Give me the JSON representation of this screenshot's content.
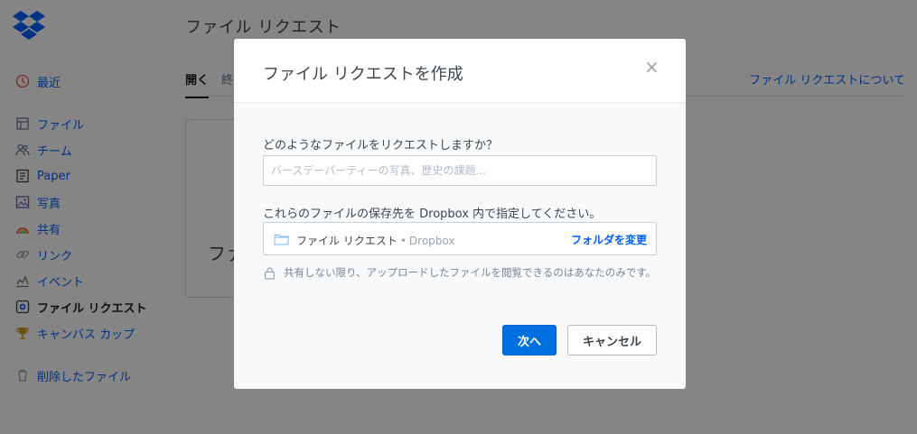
{
  "app": {
    "page_title": "ファイル リクエスト",
    "about_link": "ファイル リクエストについて",
    "card_text": "ファ"
  },
  "sidebar": {
    "items": [
      {
        "label": "最近",
        "icon": "clock-icon"
      },
      {
        "label": "ファイル",
        "icon": "files-icon"
      },
      {
        "label": "チーム",
        "icon": "team-icon"
      },
      {
        "label": "Paper",
        "icon": "paper-icon"
      },
      {
        "label": "写真",
        "icon": "photos-icon"
      },
      {
        "label": "共有",
        "icon": "sharing-icon"
      },
      {
        "label": "リンク",
        "icon": "link-icon"
      },
      {
        "label": "イベント",
        "icon": "events-icon"
      },
      {
        "label": "ファイル リクエスト",
        "icon": "file-request-icon",
        "active": true
      },
      {
        "label": "キャンバス カップ",
        "icon": "trophy-icon"
      },
      {
        "label": "削除したファイル",
        "icon": "trash-icon"
      }
    ]
  },
  "tabs": [
    {
      "label": "開く",
      "active": true
    },
    {
      "label": "終"
    }
  ],
  "modal": {
    "title": "ファイル リクエストを作成",
    "close_symbol": "×",
    "question_label": "どのようなファイルをリクエストしますか？",
    "question_placeholder": "バースデーパーティーの写真、歴史の課題...",
    "destination_label": "これらのファイルの保存先を Dropbox 内で指定してください。",
    "folder_name": "ファイル リクエスト",
    "folder_separator": "•",
    "folder_root": "Dropbox",
    "change_folder_label": "フォルダを変更",
    "privacy_text": "共有しない限り、アップロードしたファイルを閲覧できるのはあなたのみです。",
    "next_label": "次へ",
    "cancel_label": "キャンセル"
  },
  "colors": {
    "accent": "#0061fe",
    "primary_button": "#0070e0",
    "overlay": "rgba(0,0,0,0.48)"
  }
}
